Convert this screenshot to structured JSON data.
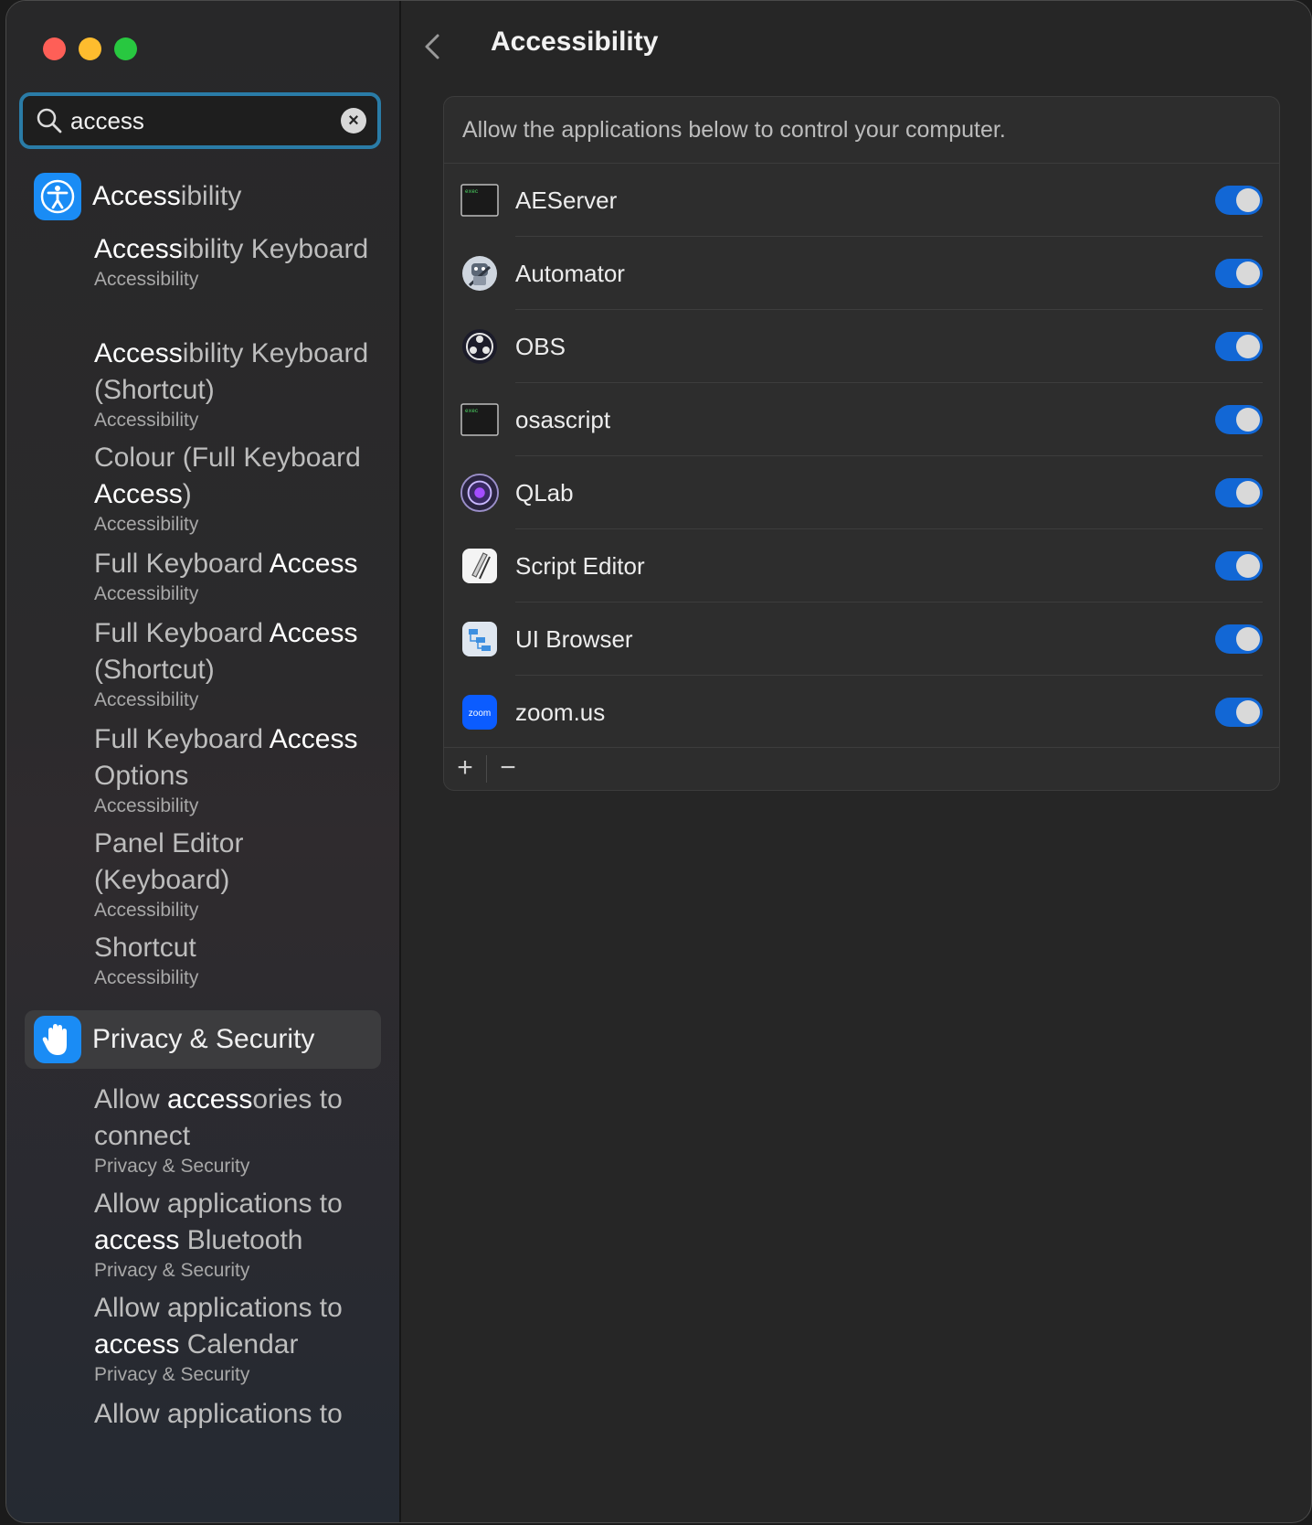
{
  "window": {
    "controls": [
      "close",
      "minimize",
      "zoom"
    ]
  },
  "search": {
    "value": "access"
  },
  "sidebar": {
    "accessibility_section": {
      "label": "Accessibility",
      "match": "Access",
      "rest": "ibility"
    },
    "accessibility_items": [
      {
        "pre": "",
        "match": "Access",
        "post": "ibility Keyboard",
        "sub": "Accessibility"
      },
      {
        "pre": "",
        "match": "Access",
        "post": "ibility Keyboard (Shortcut)",
        "sub": "Accessibility"
      },
      {
        "pre": "Colour (Full Keyboard ",
        "match": "Access",
        "post": ")",
        "sub": "Accessibility"
      },
      {
        "pre": "Full Keyboard ",
        "match": "Access",
        "post": "",
        "sub": "Accessibility"
      },
      {
        "pre": "Full Keyboard ",
        "match": "Access",
        "post": " (Shortcut)",
        "sub": "Accessibility"
      },
      {
        "pre": "Full Keyboard ",
        "match": "Access",
        "post": " Options",
        "sub": "Accessibility"
      },
      {
        "pre": "Panel Editor (Keyboard)",
        "match": "",
        "post": "",
        "sub": "Accessibility"
      },
      {
        "pre": "Shortcut",
        "match": "",
        "post": "",
        "sub": "Accessibility"
      }
    ],
    "privacy_section": {
      "label": "Privacy & Security"
    },
    "privacy_items": [
      {
        "pre": "Allow ",
        "match": "access",
        "post": "ories to connect",
        "sub": "Privacy & Security"
      },
      {
        "pre": "Allow applications to ",
        "match": "access",
        "post": " Bluetooth",
        "sub": "Privacy & Security"
      },
      {
        "pre": "Allow applications to ",
        "match": "access",
        "post": " Calendar",
        "sub": "Privacy & Security"
      },
      {
        "pre": "Allow applications to",
        "match": "",
        "post": "",
        "sub": ""
      }
    ]
  },
  "main": {
    "title": "Accessibility",
    "description": "Allow the applications below to control your computer.",
    "apps": [
      {
        "name": "AEServer",
        "icon": "exec-terminal-icon",
        "enabled": true
      },
      {
        "name": "Automator",
        "icon": "automator-robot-icon",
        "enabled": true
      },
      {
        "name": "OBS",
        "icon": "obs-icon",
        "enabled": true
      },
      {
        "name": "osascript",
        "icon": "exec-terminal-icon",
        "enabled": true
      },
      {
        "name": "QLab",
        "icon": "qlab-icon",
        "enabled": true
      },
      {
        "name": "Script Editor",
        "icon": "script-editor-icon",
        "enabled": true
      },
      {
        "name": "UI Browser",
        "icon": "ui-browser-icon",
        "enabled": true
      },
      {
        "name": "zoom.us",
        "icon": "zoom-icon",
        "enabled": true
      }
    ],
    "footer": {
      "add": "+",
      "remove": "−"
    }
  },
  "colors": {
    "accent": "#1267d5",
    "search_ring": "#2a7ca7",
    "accessibility_blue": "#1a8cf5"
  }
}
